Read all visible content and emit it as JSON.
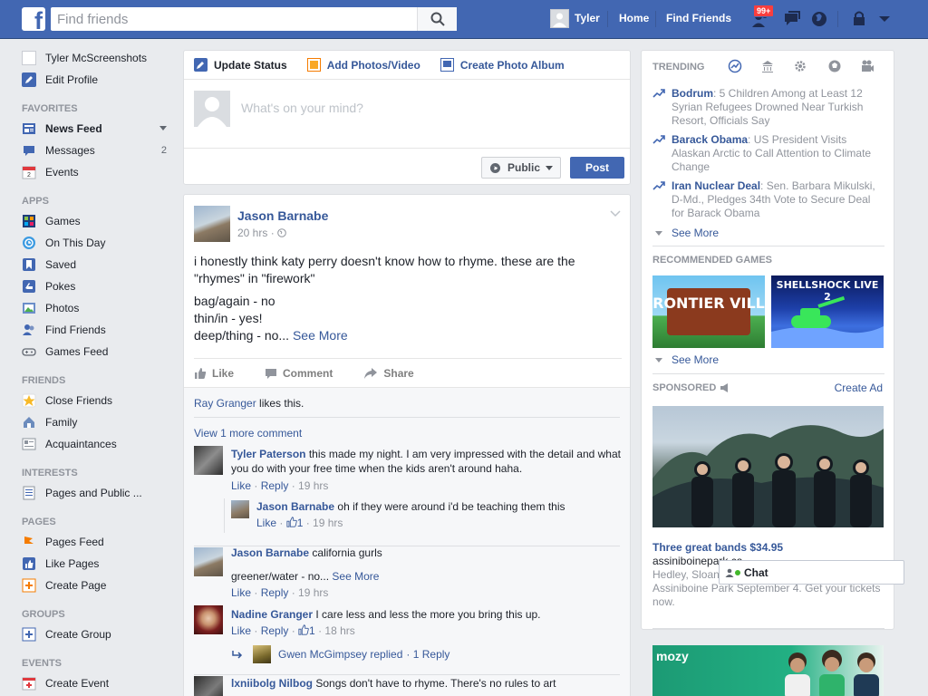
{
  "topbar": {
    "search_placeholder": "Find friends",
    "user_name": "Tyler",
    "home": "Home",
    "find_friends": "Find Friends",
    "notif_badge": "99+",
    "brand_color": "#4267b2"
  },
  "leftnav": {
    "profile_name": "Tyler McScreenshots",
    "edit_profile": "Edit Profile",
    "favorites_header": "FAVORITES",
    "favorites": [
      {
        "label": "News Feed",
        "icon": "news-feed-icon"
      },
      {
        "label": "Messages",
        "icon": "messages-icon",
        "count": "2"
      },
      {
        "label": "Events",
        "icon": "calendar-icon"
      }
    ],
    "apps_header": "APPS",
    "apps": [
      {
        "label": "Games",
        "icon": "games-icon"
      },
      {
        "label": "On This Day",
        "icon": "on-this-day-icon"
      },
      {
        "label": "Saved",
        "icon": "saved-icon"
      },
      {
        "label": "Pokes",
        "icon": "pokes-icon"
      },
      {
        "label": "Photos",
        "icon": "photos-icon"
      },
      {
        "label": "Find Friends",
        "icon": "find-friends-icon"
      },
      {
        "label": "Games Feed",
        "icon": "games-feed-icon"
      }
    ],
    "friends_header": "FRIENDS",
    "friends": [
      {
        "label": "Close Friends",
        "icon": "star-icon"
      },
      {
        "label": "Family",
        "icon": "family-icon"
      },
      {
        "label": "Acquaintances",
        "icon": "acquaintances-icon"
      }
    ],
    "interests_header": "INTERESTS",
    "interests": [
      {
        "label": "Pages and Public ...",
        "icon": "pages-list-icon"
      }
    ],
    "pages_header": "PAGES",
    "pages": [
      {
        "label": "Pages Feed",
        "icon": "pages-feed-icon"
      },
      {
        "label": "Like Pages",
        "icon": "like-pages-icon"
      },
      {
        "label": "Create Page",
        "icon": "create-page-icon"
      }
    ],
    "groups_header": "GROUPS",
    "groups": [
      {
        "label": "Create Group",
        "icon": "create-group-icon"
      }
    ],
    "events_header": "EVENTS",
    "events": [
      {
        "label": "Create Event",
        "icon": "create-event-icon"
      }
    ]
  },
  "composer": {
    "tab_status": "Update Status",
    "tab_photos": "Add Photos/Video",
    "tab_album": "Create Photo Album",
    "placeholder": "What's on your mind?",
    "privacy": "Public",
    "post": "Post"
  },
  "post": {
    "author": "Jason Barnabe",
    "time": "20 hrs",
    "line1": "i honestly think katy perry doesn't know how to rhyme. these are the \"rhymes\" in \"firework\"",
    "line2": "bag/again - no",
    "line3": "thin/in - yes!",
    "line4": "deep/thing - no...",
    "see_more": "See More",
    "like": "Like",
    "comment": "Comment",
    "share": "Share",
    "likes_name": "Ray Granger",
    "likes_suffix": "likes this.",
    "view_more": "View 1 more comment",
    "comments": [
      {
        "author": "Tyler Paterson",
        "text": "this made my night. I am very impressed with the detail and what you do with your free time when the kids aren't around haha.",
        "like": "Like",
        "reply": "Reply",
        "time": "19 hrs"
      },
      {
        "author": "Jason Barnabe",
        "text": "oh if they were around i'd be teaching them this",
        "like": "Like",
        "likes_count": "1",
        "time": "19 hrs"
      },
      {
        "author": "Jason Barnabe",
        "text": "california gurls",
        "text2": "greener/water - no...",
        "see_more": "See More",
        "like": "Like",
        "reply": "Reply",
        "time": "19 hrs"
      },
      {
        "author": "Nadine Granger",
        "text": "I care less and less the more you bring this up.",
        "like": "Like",
        "reply": "Reply",
        "likes_count": "1",
        "time": "18 hrs"
      },
      {
        "author": "lxniibolg Nilbog",
        "text": "Songs don't have to rhyme. There's no rules to art"
      }
    ],
    "replied_name": "Gwen McGimpsey replied",
    "replied_count": "1 Reply"
  },
  "rightcol": {
    "trending_header": "TRENDING",
    "trends": [
      {
        "title": "Bodrum",
        "text": ": 5 Children Among at Least 12 Syrian Refugees Drowned Near Turkish Resort, Officials Say"
      },
      {
        "title": "Barack Obama",
        "text": ": US President Visits Alaskan Arctic to Call Attention to Climate Change"
      },
      {
        "title": "Iran Nuclear Deal",
        "text": ": Sen. Barbara Mikulski, D-Md., Pledges 34th Vote to Secure Deal for Barack Obama"
      }
    ],
    "see_more": "See More",
    "games_header": "RECOMMENDED GAMES",
    "game1": "FRONTIER VILLE",
    "game2": "SHELLSHOCK LIVE 2",
    "games_see_more": "See More",
    "sponsored_header": "SPONSORED",
    "create_ad": "Create Ad",
    "ad_title": "Three great bands $34.95",
    "ad_domain": "assiniboinepark.ca",
    "ad_line1": "Hedley, Sloan",
    "ad_line2": "Assiniboine Park September 4. Get your tickets now.",
    "ad2_brand": "mozy"
  },
  "chat": {
    "label": "Chat"
  }
}
